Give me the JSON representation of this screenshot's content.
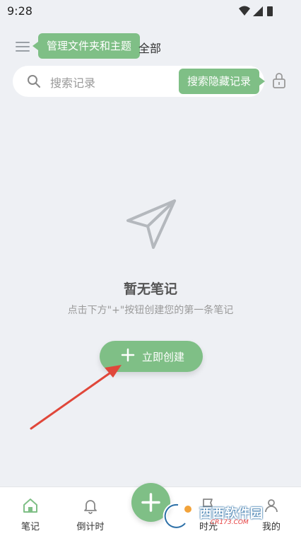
{
  "status_bar": {
    "time": "9:28"
  },
  "header": {
    "tooltip_folders": "管理文件夹和主题",
    "label": "全部"
  },
  "search": {
    "placeholder": "搜索记录",
    "tooltip_hidden": "搜索隐藏记录"
  },
  "empty_state": {
    "title": "暂无笔记",
    "subtitle": "点击下方\"+\"按钮创建您的第一条笔记",
    "create_label": "立即创建"
  },
  "tab_bar": {
    "tabs": [
      {
        "label": "笔记",
        "icon": "home-icon"
      },
      {
        "label": "倒计时",
        "icon": "bell-icon"
      },
      {
        "label": "时光",
        "icon": "flag-icon"
      },
      {
        "label": "我的",
        "icon": "user-icon"
      }
    ]
  },
  "watermark": {
    "text": "西西软件园",
    "domain": "CR173.COM"
  },
  "colors": {
    "accent": "#7fbf86",
    "background": "#eef0f4",
    "arrow": "#e0473a"
  }
}
